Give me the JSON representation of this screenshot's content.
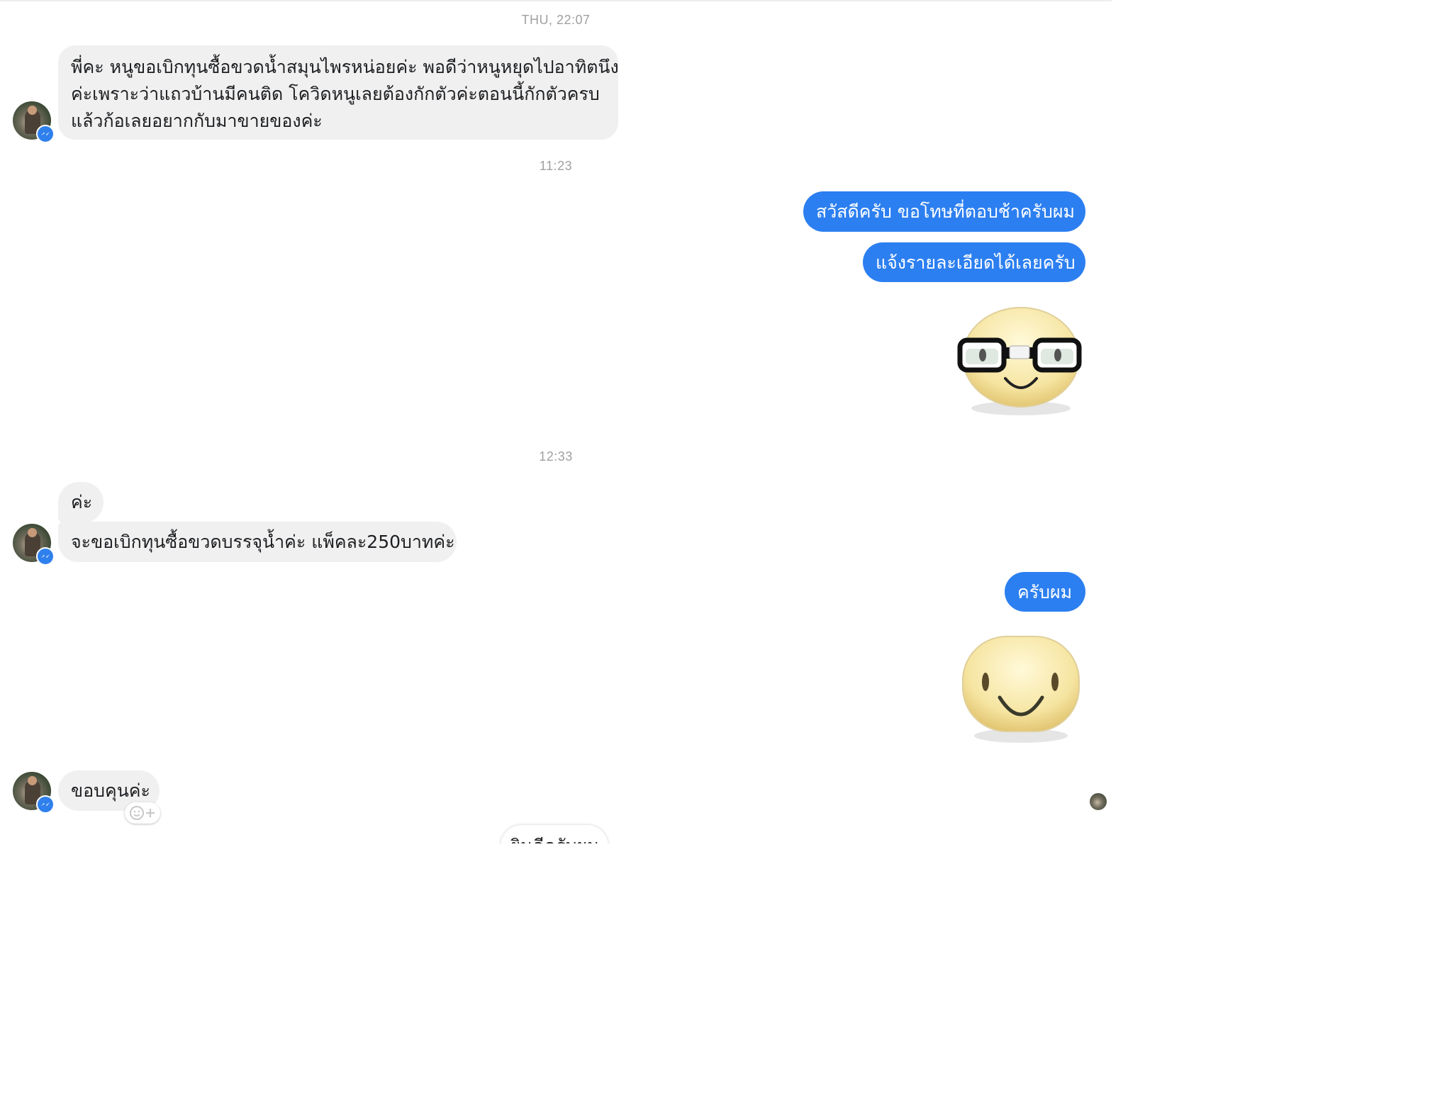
{
  "conversation": {
    "timestamps": [
      "THU, 22:07",
      "11:23",
      "12:33"
    ],
    "messages": {
      "m1_lines": [
        "พี่คะ หนูขอเบิกทุนซื้อขวดน้ำสมุนไพรหน่อยค่ะ พอดีว่าหนูหยุดไปอาทิตนึง",
        "ค่ะเพราะว่าแถวบ้านมีคนติด โควิดหนูเลยต้องกักตัวค่ะตอนนี้กักตัวครบ",
        "แล้วก้อเลยอยากกับมาขายของค่ะ"
      ],
      "m2": "สวัสดีครับ ขอโทษที่ตอบช้าครับผม",
      "m3": "แจ้งรายละเอียดได้เลยครับ",
      "m4": "ค่ะ",
      "m5": "จะขอเบิกทุนซื้อขวดบรรจุน้ำค่ะ  แพ็คละ250บาทค่ะ",
      "m6": "ครับผม",
      "m7": "ขอบคุนค่ะ"
    },
    "stickers": [
      "nerd-glasses-face-sticker",
      "smiling-face-sticker"
    ],
    "partial_bottom_text": "ยินดีครับผม"
  },
  "colors": {
    "incoming_bubble": "#f0f0f0",
    "outgoing_bubble": "#2c7ff0",
    "timestamp_text": "#a0a0a0",
    "messenger_badge": "#2f80ed"
  },
  "icons": [
    "messenger-badge-icon",
    "add-reaction-icon"
  ]
}
